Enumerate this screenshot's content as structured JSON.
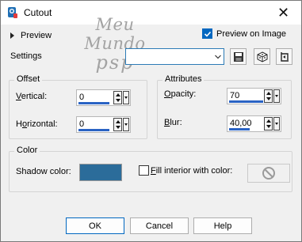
{
  "window": {
    "title": "Cutout"
  },
  "watermark": {
    "line1": "Meu Mundo",
    "line2": "psp"
  },
  "preview": {
    "label": "Preview",
    "on_image_label": "Preview on Image",
    "on_image_checked": true
  },
  "settings": {
    "label": "Settings",
    "value": ""
  },
  "offset": {
    "title": "Offset",
    "vertical": {
      "label": "Vertical:",
      "value": "0"
    },
    "horizontal": {
      "label": "Horizontal:",
      "value": "0"
    }
  },
  "attributes": {
    "title": "Attributes",
    "opacity": {
      "label": "Opacity:",
      "value": "70"
    },
    "blur": {
      "label": "Blur:",
      "value": "40,00"
    }
  },
  "color": {
    "title": "Color",
    "shadow_label": "Shadow color:",
    "shadow_color": "#2b6c9a",
    "fill_label": "Fill interior with color:",
    "fill_checked": false
  },
  "buttons": {
    "ok": "OK",
    "cancel": "Cancel",
    "help": "Help"
  }
}
